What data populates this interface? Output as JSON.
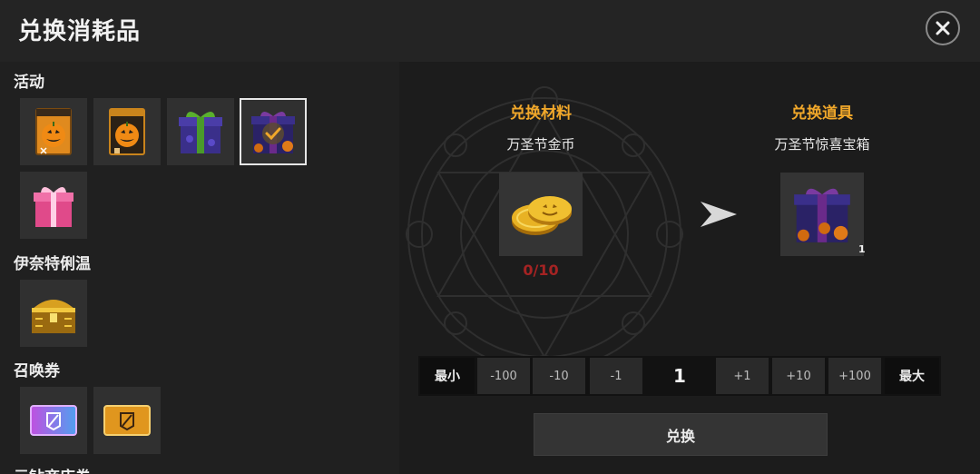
{
  "window": {
    "title": "兑换消耗品"
  },
  "categories": [
    {
      "label": "活动"
    },
    {
      "label": "伊奈特俐温"
    },
    {
      "label": "召唤券"
    },
    {
      "label": "元钻商店券"
    }
  ],
  "items": {
    "activity": [
      {
        "icon": "pumpkin-ticket-icon"
      },
      {
        "icon": "pumpkin-ticket-icon"
      },
      {
        "icon": "green-ribbon-gift-box-icon"
      },
      {
        "icon": "halloween-surprise-box-icon",
        "selected": true
      },
      {
        "icon": "pink-gift-box-icon"
      }
    ],
    "inaterivan": [
      {
        "icon": "golden-treasure-chest-icon"
      }
    ],
    "summon": [
      {
        "icon": "purple-summon-ticket-icon"
      },
      {
        "icon": "gold-summon-ticket-icon"
      }
    ]
  },
  "exchange": {
    "material_label": "兑换材料",
    "material_name": "万圣节金币",
    "material_count": "0/10",
    "material_icon": "gold-coins-icon",
    "item_label": "兑换道具",
    "item_name": "万圣节惊喜宝箱",
    "item_quantity": "1",
    "item_icon": "halloween-surprise-box-icon"
  },
  "quantity": {
    "min_label": "最小",
    "minus100": "-100",
    "minus10": "-10",
    "minus1": "-1",
    "value": "1",
    "plus1": "+1",
    "plus10": "+10",
    "plus100": "+100",
    "max_label": "最大"
  },
  "action": {
    "exchange_label": "兑换"
  },
  "colors": {
    "accent": "#f0a72a",
    "count_red": "#a52323",
    "panel": "#202020"
  }
}
